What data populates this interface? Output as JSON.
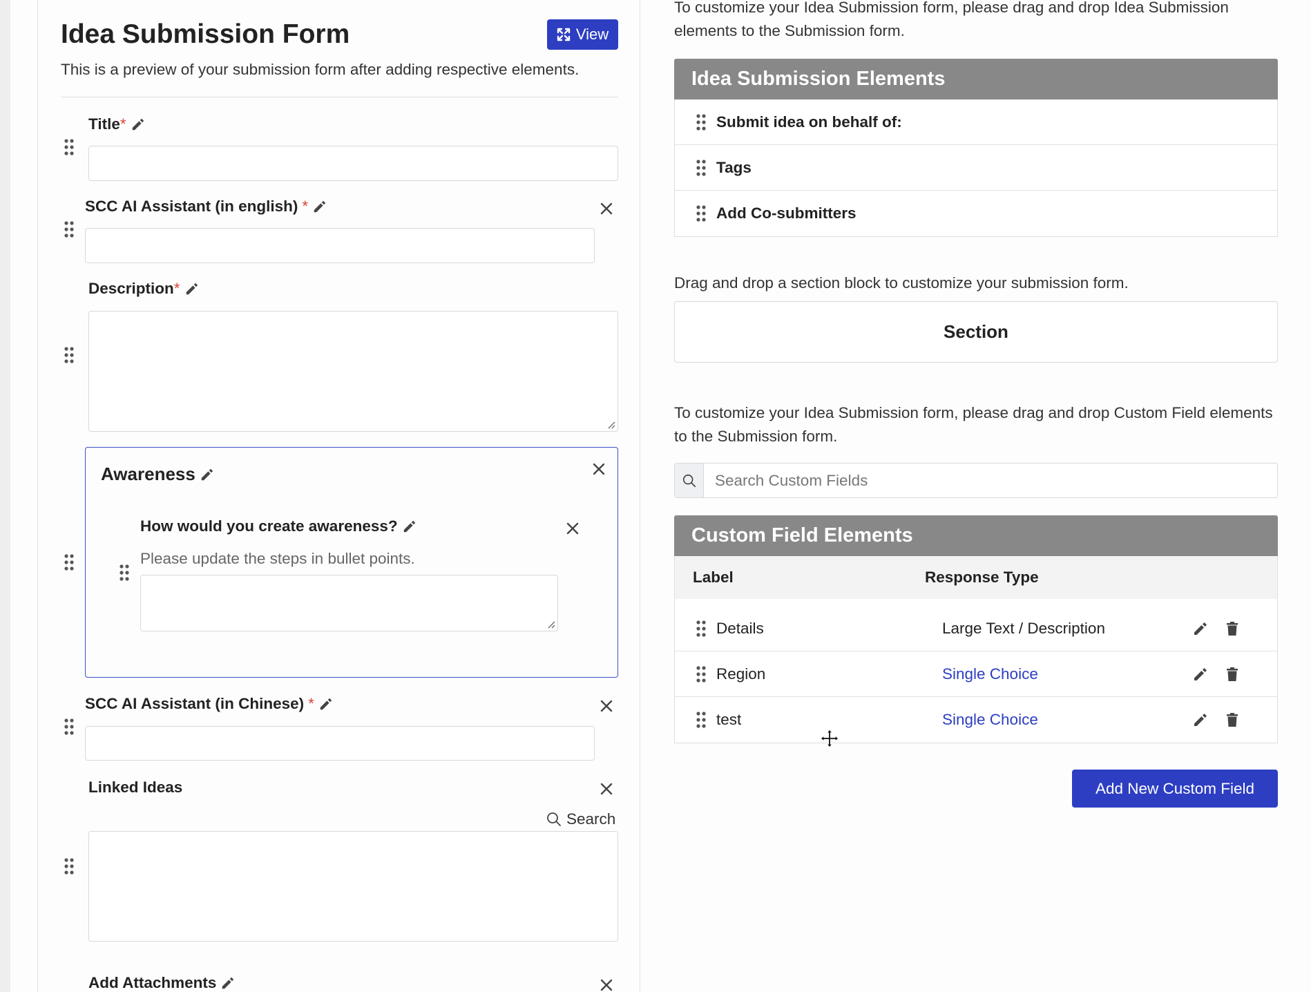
{
  "form": {
    "title": "Idea Submission Form",
    "view_label": "View",
    "subtitle": "This is a preview of your submission form after adding respective elements.",
    "fields": {
      "title": "Title",
      "scc_english": "SCC AI Assistant (in english)",
      "description": "Description",
      "section_title": "Awareness",
      "question": "How would you create awareness?",
      "question_hint": "Please update the steps in bullet points.",
      "scc_chinese": "SCC AI Assistant (in Chinese)",
      "linked_ideas": "Linked Ideas",
      "linked_search": "Search",
      "attachments": "Add Attachments"
    },
    "required_mark": "*"
  },
  "elements": {
    "intro": "To customize your Idea Submission form, please drag and drop Idea Submission elements to the Submission form.",
    "header": "Idea Submission Elements",
    "items": [
      "Submit idea on behalf of:",
      "Tags",
      "Add Co-submitters"
    ]
  },
  "section_block": {
    "hint": "Drag and drop a section block to customize your submission form.",
    "label": "Section"
  },
  "custom_fields": {
    "intro": "To customize your Idea Submission form, please drag and drop Custom Field elements to the Submission form.",
    "search_placeholder": "Search Custom Fields",
    "header": "Custom Field Elements",
    "columns": {
      "label": "Label",
      "response_type": "Response Type"
    },
    "rows": [
      {
        "label": "Details",
        "type": "Large Text / Description"
      },
      {
        "label": "Region",
        "type": "Single Choice"
      },
      {
        "label": "test",
        "type": "Single Choice"
      }
    ],
    "add_button": "Add New Custom Field"
  },
  "colors": {
    "primary": "#2d3ec2",
    "panel_header": "#888888",
    "required": "#d9443a"
  }
}
